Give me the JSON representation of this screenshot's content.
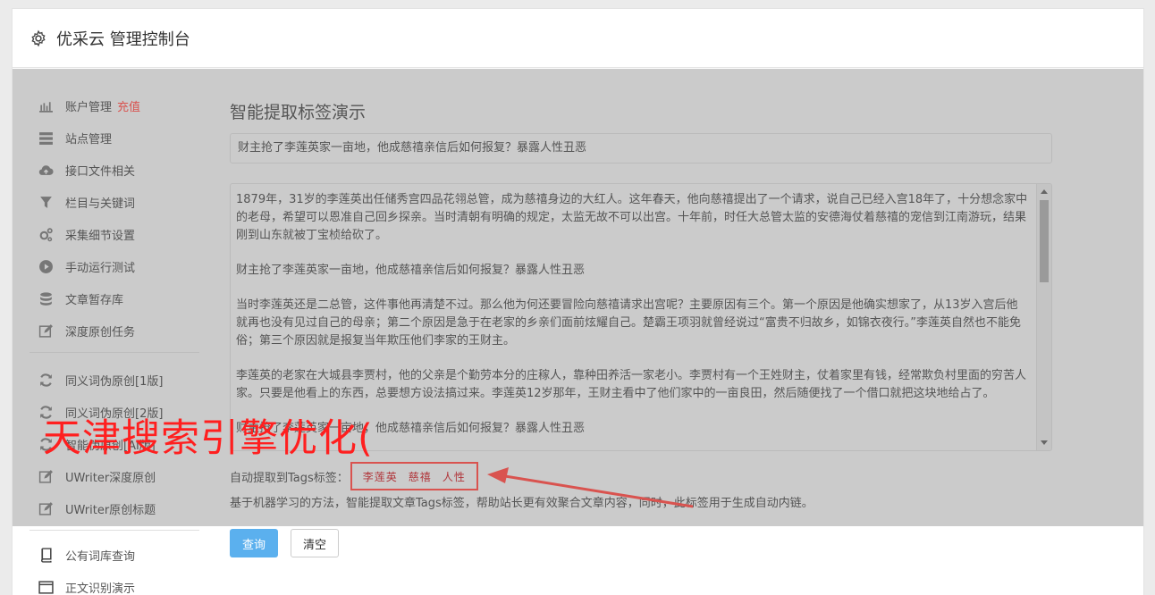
{
  "header": {
    "title": "优采云 管理控制台",
    "icon": "gear-icon"
  },
  "sidebar": {
    "items": [
      {
        "label": "账户管理",
        "extra": "充值",
        "icon": "bar-chart-icon"
      },
      {
        "label": "站点管理",
        "icon": "list-icon"
      },
      {
        "label": "接口文件相关",
        "icon": "cloud-upload-icon"
      },
      {
        "label": "栏目与关键词",
        "icon": "filter-icon"
      },
      {
        "label": "采集细节设置",
        "icon": "gears-icon"
      },
      {
        "label": "手动运行测试",
        "icon": "play-circle-icon"
      },
      {
        "label": "文章暂存库",
        "icon": "database-icon"
      },
      {
        "label": "深度原创任务",
        "icon": "edit-icon"
      }
    ],
    "items2": [
      {
        "label": "同义词伪原创[1版]",
        "icon": "refresh-icon"
      },
      {
        "label": "同义词伪原创[2版]",
        "icon": "refresh-icon"
      },
      {
        "label": "智能伪原创[AI版]",
        "icon": "refresh-icon"
      },
      {
        "label": "UWriter深度原创",
        "icon": "edit-icon"
      },
      {
        "label": "UWriter原创标题",
        "icon": "edit-icon"
      }
    ],
    "items3": [
      {
        "label": "公有词库查询",
        "icon": "book-icon"
      },
      {
        "label": "正文识别演示",
        "icon": "window-icon"
      }
    ]
  },
  "main": {
    "title": "智能提取标签演示",
    "title_input_value": "财主抢了李莲英家一亩地，他成慈禧亲信后如何报复？暴露人性丑恶",
    "article_paragraphs": [
      "1879年，31岁的李莲英出任储秀宫四品花翎总管，成为慈禧身边的大红人。这年春天，他向慈禧提出了一个请求，说自己已经入宫18年了，十分想念家中的老母，希望可以恩准自己回乡探亲。当时清朝有明确的规定，太监无故不可以出宫。十年前，时任大总管太监的安德海仗着慈禧的宠信到江南游玩，结果刚到山东就被丁宝桢给砍了。",
      "财主抢了李莲英家一亩地，他成慈禧亲信后如何报复？暴露人性丑恶",
      "当时李莲英还是二总管，这件事他再清楚不过。那么他为何还要冒险向慈禧请求出宫呢？主要原因有三个。第一个原因是他确实想家了，从13岁入宫后他就再也没有见过自己的母亲；第二个原因是急于在老家的乡亲们面前炫耀自己。楚霸王项羽就曾经说过“富贵不归故乡，如锦衣夜行。”李莲英自然也不能免俗；第三个原因就是报复当年欺压他们李家的王财主。",
      "李莲英的老家在大城县李贾村，他的父亲是个勤劳本分的庄稼人，靠种田养活一家老小。李贾村有一个王姓财主，仗着家里有钱，经常欺负村里面的穷苦人家。只要是他看上的东西，总要想方设法搞过来。李莲英12岁那年，王财主看中了他们家中的一亩良田，然后随便找了一个借口就把这块地给占了。",
      "财主抢了李莲英家一亩地，他成慈禧亲信后如何报复？暴露人性丑恶"
    ],
    "tags_label": "自动提取到Tags标签：",
    "tags": [
      "李莲英",
      "慈禧",
      "人性"
    ],
    "description": "基于机器学习的方法，智能提取文章Tags标签，帮助站长更有效聚合文章内容，同时，此标签用于生成自动内链。",
    "query_button": "查询",
    "clear_button": "清空"
  },
  "watermark": "天津搜索引擎优化(",
  "colors": {
    "accent": "#5bb0ee",
    "warning": "#d9534f",
    "watermark": "#ff1f1f"
  }
}
